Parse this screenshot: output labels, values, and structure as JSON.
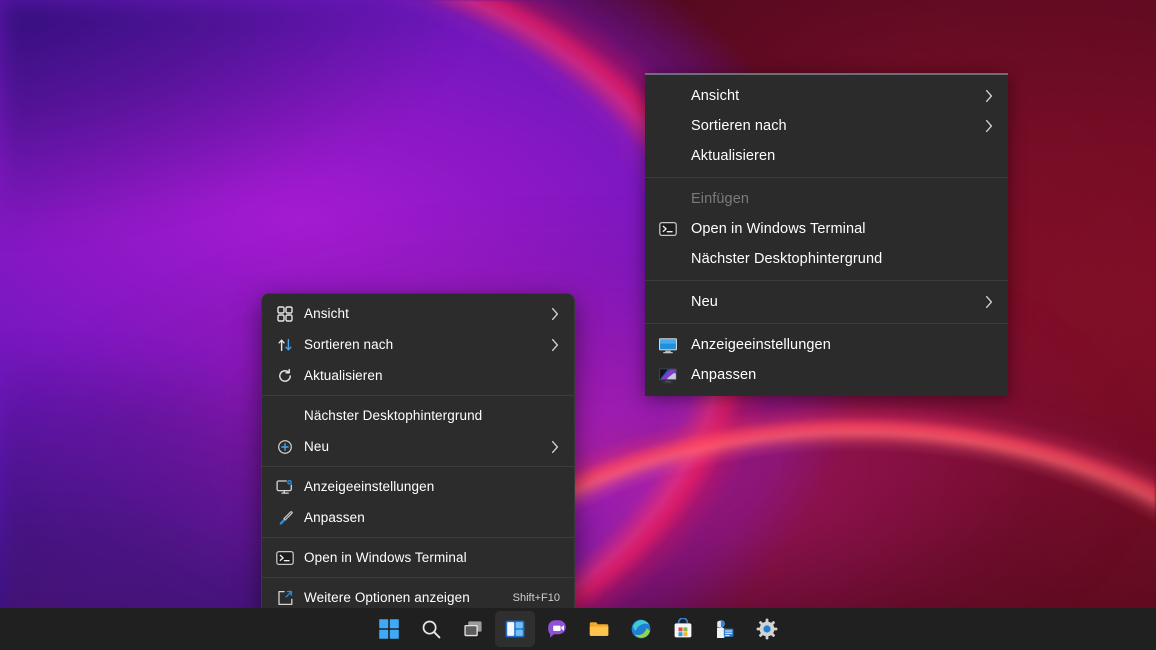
{
  "desktop": {
    "wallpaper_name": "windows-11-bloom-wallpaper",
    "colors": {
      "purple": "#8a18c4",
      "magenta": "#e026a8",
      "crimson": "#8d0f2a",
      "coral": "#fc4660",
      "indigo": "#2b0f7e",
      "menu_bg": "#2c2c2c",
      "menu_text": "#ffffff",
      "menu_disabled_text": "#7b7b7b",
      "separator": "#3d3d3d",
      "taskbar_bg": "#202020",
      "accent_blue": "#0078d4"
    }
  },
  "classic_menu": {
    "name": "desktop-classic-context-menu",
    "groups": [
      {
        "items": [
          {
            "label": "Ansicht",
            "icon": "none",
            "submenu": true,
            "disabled": false,
            "accel": ""
          },
          {
            "label": "Sortieren nach",
            "icon": "none",
            "submenu": true,
            "disabled": false,
            "accel": ""
          },
          {
            "label": "Aktualisieren",
            "icon": "none",
            "submenu": false,
            "disabled": false,
            "accel": ""
          }
        ]
      },
      {
        "items": [
          {
            "label": "Einfügen",
            "icon": "none",
            "submenu": false,
            "disabled": true,
            "accel": ""
          },
          {
            "label": "Open in Windows Terminal",
            "icon": "terminal-icon",
            "submenu": false,
            "disabled": false,
            "accel": ""
          },
          {
            "label": "Nächster Desktophintergrund",
            "icon": "none",
            "submenu": false,
            "disabled": false,
            "accel": ""
          }
        ]
      },
      {
        "items": [
          {
            "label": "Neu",
            "icon": "none",
            "submenu": true,
            "disabled": false,
            "accel": ""
          }
        ]
      },
      {
        "items": [
          {
            "label": "Anzeigeeinstellungen",
            "icon": "display-settings-icon",
            "submenu": false,
            "disabled": false,
            "accel": ""
          },
          {
            "label": "Anpassen",
            "icon": "personalize-icon",
            "submenu": false,
            "disabled": false,
            "accel": ""
          }
        ]
      }
    ]
  },
  "modern_menu": {
    "name": "desktop-win11-context-menu",
    "groups": [
      {
        "items": [
          {
            "label": "Ansicht",
            "icon": "view-grid-icon",
            "submenu": true,
            "disabled": false,
            "accel": ""
          },
          {
            "label": "Sortieren nach",
            "icon": "sort-arrows-icon",
            "submenu": true,
            "disabled": false,
            "accel": ""
          },
          {
            "label": "Aktualisieren",
            "icon": "refresh-icon",
            "submenu": false,
            "disabled": false,
            "accel": ""
          }
        ]
      },
      {
        "items": [
          {
            "label": "Nächster Desktophintergrund",
            "icon": "none",
            "submenu": false,
            "disabled": false,
            "accel": ""
          },
          {
            "label": "Neu",
            "icon": "plus-circle-icon",
            "submenu": true,
            "disabled": false,
            "accel": ""
          }
        ]
      },
      {
        "items": [
          {
            "label": "Anzeigeeinstellungen",
            "icon": "display-settings-icon",
            "submenu": false,
            "disabled": false,
            "accel": ""
          },
          {
            "label": "Anpassen",
            "icon": "paintbrush-icon",
            "submenu": false,
            "disabled": false,
            "accel": ""
          }
        ]
      },
      {
        "items": [
          {
            "label": "Open in Windows Terminal",
            "icon": "terminal-icon",
            "submenu": false,
            "disabled": false,
            "accel": ""
          }
        ]
      },
      {
        "items": [
          {
            "label": "Weitere Optionen anzeigen",
            "icon": "show-more-options-icon",
            "submenu": false,
            "disabled": false,
            "accel": "Shift+F10"
          }
        ]
      }
    ]
  },
  "taskbar": {
    "name": "windows-taskbar",
    "buttons": [
      {
        "label": "Start",
        "icon": "windows-start-icon",
        "active": false
      },
      {
        "label": "Suchen",
        "icon": "search-icon",
        "active": false
      },
      {
        "label": "Taskansicht",
        "icon": "task-view-icon",
        "active": false
      },
      {
        "label": "Widgets",
        "icon": "widgets-icon",
        "active": true
      },
      {
        "label": "Chat",
        "icon": "teams-chat-icon",
        "active": false
      },
      {
        "label": "Explorer",
        "icon": "file-explorer-icon",
        "active": false
      },
      {
        "label": "Microsoft Edge",
        "icon": "edge-icon",
        "active": false
      },
      {
        "label": "Microsoft Store",
        "icon": "microsoft-store-icon",
        "active": false
      },
      {
        "label": "App",
        "icon": "app-window-icon",
        "active": false
      },
      {
        "label": "Einstellungen",
        "icon": "settings-gear-icon",
        "active": false
      }
    ]
  }
}
